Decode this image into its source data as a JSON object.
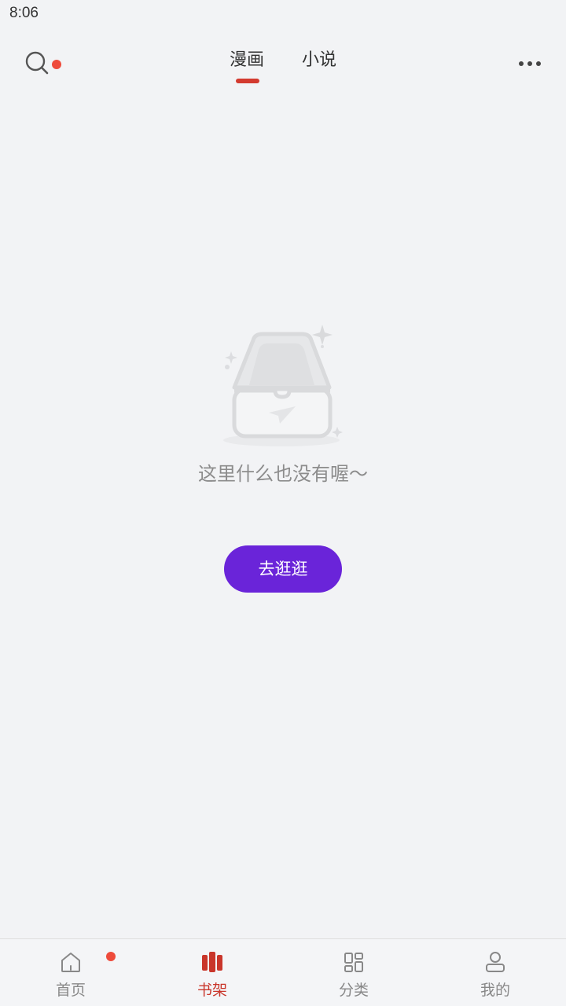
{
  "status_bar": {
    "time": "8:06"
  },
  "top_bar": {
    "search_icon": "search-icon",
    "tabs": [
      {
        "label": "漫画",
        "active": true
      },
      {
        "label": "小说",
        "active": false
      }
    ],
    "more_icon": "more-dots-icon"
  },
  "empty_state": {
    "illustration": "empty-box-icon",
    "message": "这里什么也没有喔～",
    "button_label": "去逛逛"
  },
  "bottom_nav": {
    "items": [
      {
        "label": "首页",
        "icon": "home-icon",
        "active": false
      },
      {
        "label": "书架",
        "icon": "bookshelf-icon",
        "active": true
      },
      {
        "label": "分类",
        "icon": "category-grid-icon",
        "active": false
      },
      {
        "label": "我的",
        "icon": "profile-icon",
        "active": false
      }
    ]
  },
  "colors": {
    "accent": "#d33a2f",
    "button": "#6a24d9",
    "badge": "#ee4b3b",
    "background": "#f2f3f5"
  }
}
